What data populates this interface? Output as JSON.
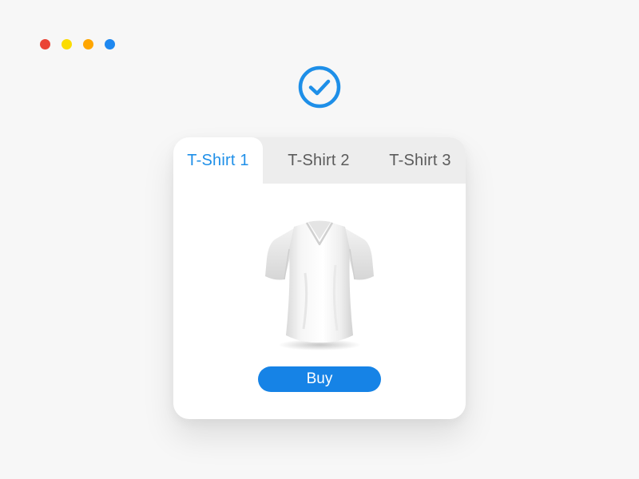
{
  "window_controls": {
    "colors": [
      "#ea4335",
      "#fbdc00",
      "#ffa600",
      "#1e88f0"
    ]
  },
  "status": {
    "icon": "check-circle-icon",
    "color": "#1e8fe8"
  },
  "tabs": [
    {
      "label": "T-Shirt 1",
      "active": true
    },
    {
      "label": "T-Shirt 2",
      "active": false
    },
    {
      "label": "T-Shirt 3",
      "active": false
    }
  ],
  "product": {
    "image_icon": "tshirt-icon",
    "buy_label": "Buy"
  },
  "colors": {
    "accent": "#1e8fe8",
    "button": "#1683e6",
    "tabbar": "#ededed",
    "background": "#f7f7f7"
  }
}
